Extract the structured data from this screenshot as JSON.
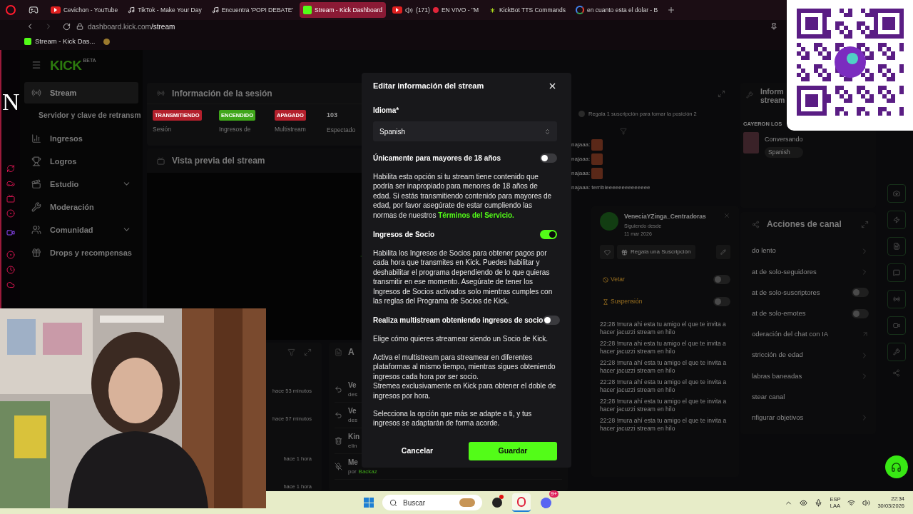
{
  "browser": {
    "tabs": [
      {
        "title": "Cevichon - YouTube",
        "kind": "video",
        "selected": false,
        "audio": false,
        "live": false
      },
      {
        "title": "TikTok - Make Your Day",
        "kind": "music",
        "selected": false,
        "audio": false,
        "live": false
      },
      {
        "title": "Encuentra 'POPI DEBATE'",
        "kind": "music",
        "selected": false,
        "audio": false,
        "live": false
      },
      {
        "title": "Stream - Kick Dashboard",
        "kind": "kick",
        "selected": true,
        "audio": false,
        "live": false
      },
      {
        "title": "EN VIVO - \"M",
        "kind": "video",
        "selected": false,
        "count": "(171)",
        "audio": true,
        "live": true
      },
      {
        "title": "KickBot TTS Commands",
        "kind": "bot",
        "selected": false,
        "audio": false,
        "live": false
      },
      {
        "title": "en cuanto esta el dolar - B",
        "kind": "search",
        "selected": false,
        "audio": false,
        "live": false
      }
    ],
    "url_host": "dashboard.kick.com",
    "url_path": "/stream",
    "bookmarks": [
      {
        "title": "Stream - Kick Das..."
      }
    ]
  },
  "overlay": {
    "letter": "N"
  },
  "nav": {
    "logo": "KICK",
    "logo_badge": "BETA",
    "items": [
      {
        "label": "Stream",
        "kind": "stream",
        "selected": true,
        "expandable": false,
        "children": [
          {
            "label": "Servidor y clave de retransm",
            "selected": false
          }
        ]
      },
      {
        "label": "Ingresos",
        "kind": "chart",
        "selected": false,
        "expandable": false
      },
      {
        "label": "Logros",
        "kind": "trophy",
        "selected": false,
        "expandable": false
      },
      {
        "label": "Estudio",
        "kind": "studio",
        "selected": false,
        "expandable": true
      },
      {
        "label": "Moderación",
        "kind": "wrench",
        "selected": false,
        "expandable": false
      },
      {
        "label": "Comunidad",
        "kind": "users",
        "selected": false,
        "expandable": true
      },
      {
        "label": "Drops y recompensas",
        "kind": "drops",
        "selected": false,
        "expandable": false
      }
    ]
  },
  "session": {
    "title": "Información de la sesión",
    "stats": [
      {
        "value": "TRANSMITIENDO",
        "label": "Sesión",
        "kind": "badge",
        "color": "#b3202c"
      },
      {
        "value": "ENCENDIDO",
        "label": "Ingresos de",
        "kind": "badge",
        "color": "#3fa61a"
      },
      {
        "value": "APAGADO",
        "label": "Multistream",
        "kind": "badge",
        "color": "#b3202c"
      },
      {
        "value": "103",
        "label": "Espectado",
        "kind": "number"
      }
    ]
  },
  "preview": {
    "title": "Vista previa del stream"
  },
  "history": {
    "times": [
      "hace 53 minutos",
      "hace 57 minutos",
      "hace 1 hora",
      "hace 1 hora"
    ]
  },
  "activity": {
    "title": "A",
    "items": [
      {
        "kind": "undo",
        "title": "Ve",
        "sub": "des"
      },
      {
        "kind": "undo",
        "title": "Ve",
        "sub": "des"
      },
      {
        "kind": "trash",
        "title": "Kin",
        "sub": "elin"
      },
      {
        "kind": "mute",
        "title": "Me",
        "sub": "por",
        "user": "Backaz"
      }
    ]
  },
  "chat": {
    "notice": "Regala 1 suscripción para tomar la posición 2",
    "messages": [
      {
        "user": "najaaa:",
        "kind": "emote"
      },
      {
        "user": "najaaa:",
        "kind": "emote"
      },
      {
        "user": "najaaa:",
        "kind": "emote"
      },
      {
        "user": "najaaa:",
        "kind": "text",
        "text": "terribleeeeeeeeeeeeee"
      }
    ]
  },
  "user_card": {
    "name": "VeneciaYZinga_Centradoras",
    "since_label": "Siguiendo desde",
    "since": "11 mar 2026",
    "gift": "Regala una Suscripción",
    "actions": [
      {
        "label": "Vetar",
        "kind": "ban",
        "on": false
      },
      {
        "label": "Suspensión",
        "kind": "timer",
        "on": false
      }
    ],
    "history": [
      "22:28 !mura ahi esta tu amigo el que te invita a hacer jacuzzi stream en hilo",
      "22:28 !mura ahi esta tu amigo el que te invita a hacer jacuzzi stream en hilo",
      "22:28 !mura ahí esta tu amigo el que te invita a hacer jacuzzi stream en hilo",
      "22:28 !mura ahí esta tu amigo el que te invita a hacer jacuzzi stream en hilo",
      "22:28 !mura ahí esta tu amigo el que te invita a hacer jacuzzi stream en hilo",
      "22:28 !mura ahí esta tu amigo el que te invita a hacer jacuzzi stream en hilo"
    ]
  },
  "stream_info": {
    "title_lines": [
      "Inform",
      "stream"
    ],
    "category": "CAYERON LOS",
    "subtitle": "Conversando",
    "tag": "Spanish"
  },
  "actions": {
    "title": "Acciones de canal",
    "items": [
      {
        "label": "do lento",
        "kind": "arrow"
      },
      {
        "label": "at de solo-seguidores",
        "kind": "arrow"
      },
      {
        "label": "at de solo-suscriptores",
        "kind": "toggle",
        "on": false
      },
      {
        "label": "at de solo-emotes",
        "kind": "toggle",
        "on": false
      },
      {
        "label": "oderación del chat con IA",
        "kind": "external"
      },
      {
        "label": "stricción de edad",
        "kind": "arrow"
      },
      {
        "label": "labras baneadas",
        "kind": "arrow"
      },
      {
        "label": "stear canal",
        "kind": "none"
      },
      {
        "label": "nfigurar objetivos",
        "kind": "arrow"
      }
    ]
  },
  "modal": {
    "title": "Editar información del stream",
    "language_label": "Idioma*",
    "language": "Spanish",
    "sections": [
      {
        "kind": "toggle",
        "label": "Únicamente para mayores de 18 años",
        "on": false
      },
      {
        "kind": "text",
        "lines": [
          "Habilita esta opción si tu stream tiene contenido que podría ser inapropiado para menores de 18 años de edad. Si estás transmitiendo contenido para mayores de edad, por favor asegúrate de estar cumpliendo las normas de nuestros"
        ],
        "link": "Términos del Servicio."
      },
      {
        "kind": "toggle",
        "label": "Ingresos de Socio",
        "on": true
      },
      {
        "kind": "text",
        "lines": [
          "Habilita los Ingresos de Socios para obtener pagos por cada hora que transmites en Kick. Puedes habilitar y deshabilitar el programa dependiendo de lo que quieras transmitir en ese momento. Asegúrate de tener los Ingresos de Socios activados solo mientras cumples con las reglas del Programa de Socios de Kick."
        ]
      },
      {
        "kind": "toggle",
        "label": "Realiza multistream obteniendo ingresos de socio",
        "on": false
      },
      {
        "kind": "text",
        "lines": [
          "Elige cómo quieres streamear siendo un Socio de Kick."
        ]
      },
      {
        "kind": "text",
        "lines": [
          "Activa el multistream para streamear en diferentes plataformas al mismo tiempo, mientras sigues obteniendo ingresos cada hora por ser socio.",
          "Stremea exclusivamente en Kick para obtener el doble de ingresos por hora."
        ]
      },
      {
        "kind": "text",
        "lines": [
          "Selecciona la opción que más se adapte a ti, y tus ingresos se adaptarán de forma acorde."
        ]
      }
    ],
    "cancel": "Cancelar",
    "save": "Guardar"
  },
  "taskbar": {
    "search": "Buscar",
    "apps": [
      {
        "kind": "obs",
        "selected": false,
        "alert": true
      },
      {
        "kind": "opera",
        "selected": true,
        "alert": false
      },
      {
        "kind": "discord",
        "selected": false,
        "alert": false,
        "badge": "9+"
      }
    ],
    "lang_1": "ESP",
    "lang_2": "LAA",
    "time": "22:34",
    "date": "30/03/2026"
  }
}
